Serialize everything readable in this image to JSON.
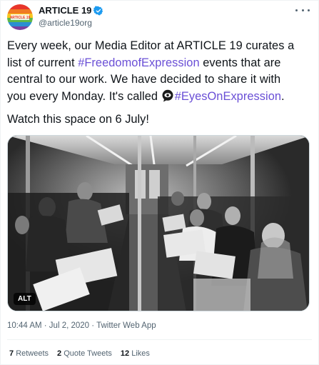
{
  "tweet": {
    "display_name": "ARTICLE 19",
    "handle": "@article19org",
    "avatar_text": "ARTICLE 19",
    "line1": "Every week, our Media Editor at ARTICLE 19 curates a",
    "line2_pre": "list of current ",
    "hashtag1": "#FreedomofExpression",
    "line2_post": " events that are",
    "line3": "central to our work. We have decided to share it with",
    "line4_pre": "you every Monday. It's called ",
    "hashtag2": "#EyesOnExpression",
    "line4_post": ".",
    "watch": "Watch this space on 6 July!",
    "media_alt_label": "ALT",
    "meta": "10:44 AM · Jul 2, 2020 · Twitter Web App",
    "retweets_count": "7",
    "retweets_label": "Retweets",
    "quotes_count": "2",
    "quotes_label": "Quote Tweets",
    "likes_count": "12",
    "likes_label": "Likes"
  },
  "colors": {
    "hashtag": "#6a4fd6",
    "verified": "#1d9bf0",
    "secondary_text": "#536471"
  },
  "icons": {
    "verified": "verified-badge-icon",
    "more": "more-dots-icon",
    "eyes": "eye-speech-bubble-icon"
  }
}
